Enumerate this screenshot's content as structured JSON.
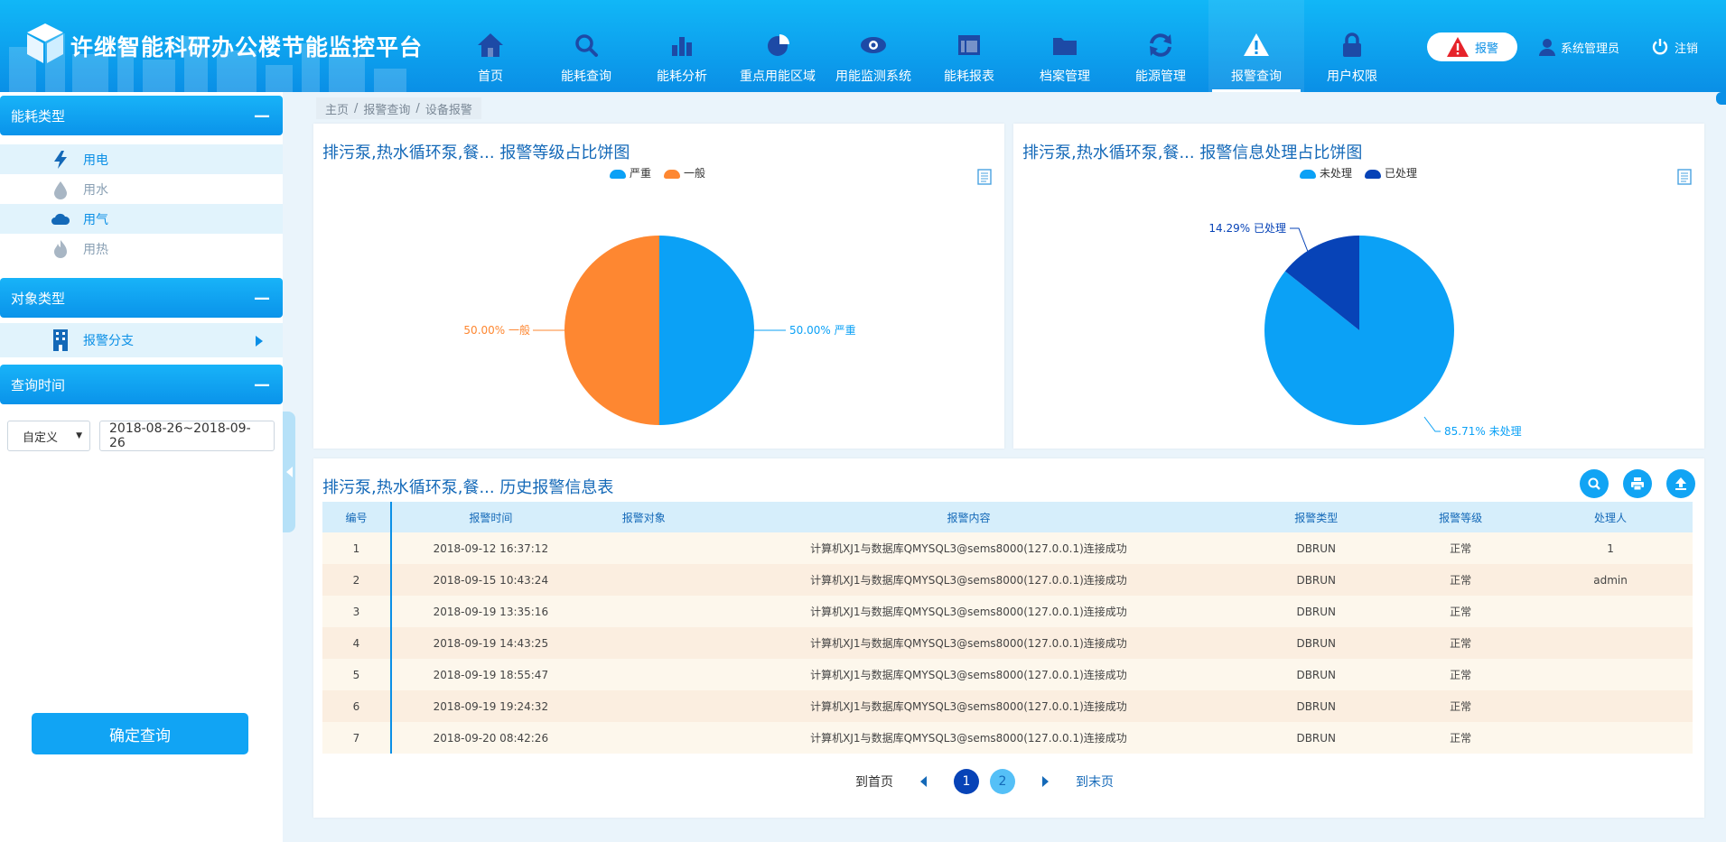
{
  "app": {
    "title": "许继智能科研办公楼节能监控平台"
  },
  "nav": [
    {
      "label": "首页",
      "icon": "home-icon"
    },
    {
      "label": "能耗查询",
      "icon": "search-icon"
    },
    {
      "label": "能耗分析",
      "icon": "bar-chart-icon"
    },
    {
      "label": "重点用能区域",
      "icon": "pie-icon"
    },
    {
      "label": "用能监测系统",
      "icon": "eye-icon"
    },
    {
      "label": "能耗报表",
      "icon": "report-icon"
    },
    {
      "label": "档案管理",
      "icon": "folder-icon"
    },
    {
      "label": "能源管理",
      "icon": "refresh-icon"
    },
    {
      "label": "报警查询",
      "icon": "warning-icon",
      "active": true
    },
    {
      "label": "用户权限",
      "icon": "lock-icon"
    }
  ],
  "header": {
    "alarm_label": "报警",
    "user_name": "系统管理员",
    "logout_label": "注销"
  },
  "sidebar": {
    "energy_panel_title": "能耗类型",
    "energy_items": [
      {
        "label": "用电",
        "icon": "lightning-icon",
        "selected": true
      },
      {
        "label": "用水",
        "icon": "water-drop-icon"
      },
      {
        "label": "用气",
        "icon": "cloud-icon",
        "selected": true
      },
      {
        "label": "用热",
        "icon": "flame-icon"
      }
    ],
    "object_panel_title": "对象类型",
    "object_item": "报警分支",
    "time_panel_title": "查询时间",
    "time_mode": "自定义",
    "date_range": "2018-08-26~2018-09-26",
    "confirm_label": "确定查询"
  },
  "breadcrumb": [
    "主页",
    "报警查询",
    "设备报警"
  ],
  "level_card": {
    "title": "排污泵,热水循环泵,餐...   报警等级占比饼图",
    "legend": [
      "严重",
      "一般"
    ],
    "labels": [
      "50.00%  严重",
      "50.00%  一般"
    ]
  },
  "process_card": {
    "title": "排污泵,热水循环泵,餐...   报警信息处理占比饼图",
    "legend": [
      "未处理",
      "已处理"
    ],
    "labels": [
      "85.71%  未处理",
      "14.29%  已处理"
    ]
  },
  "chart_data": [
    {
      "type": "pie",
      "title": "报警等级占比饼图",
      "categories": [
        "严重",
        "一般"
      ],
      "values": [
        50.0,
        50.0
      ],
      "colors": [
        "#0ba1f6",
        "#fe8731"
      ],
      "legend": "top-center"
    },
    {
      "type": "pie",
      "title": "报警信息处理占比饼图",
      "categories": [
        "未处理",
        "已处理"
      ],
      "values": [
        85.71,
        14.29
      ],
      "colors": [
        "#0ba1f6",
        "#0743b7"
      ],
      "legend": "top-center"
    }
  ],
  "history": {
    "title": "排污泵,热水循环泵,餐...   历史报警信息表",
    "columns": [
      "编号",
      "报警时间",
      "报警对象",
      "报警内容",
      "报警类型",
      "报警等级",
      "处理人"
    ],
    "rows": [
      [
        "1",
        "2018-09-12 16:37:12",
        "",
        "计算机XJ1与数据库QMYSQL3@sems8000(127.0.0.1)连接成功",
        "DBRUN",
        "正常",
        "1"
      ],
      [
        "2",
        "2018-09-15 10:43:24",
        "",
        "计算机XJ1与数据库QMYSQL3@sems8000(127.0.0.1)连接成功",
        "DBRUN",
        "正常",
        "admin"
      ],
      [
        "3",
        "2018-09-19 13:35:16",
        "",
        "计算机XJ1与数据库QMYSQL3@sems8000(127.0.0.1)连接成功",
        "DBRUN",
        "正常",
        ""
      ],
      [
        "4",
        "2018-09-19 14:43:25",
        "",
        "计算机XJ1与数据库QMYSQL3@sems8000(127.0.0.1)连接成功",
        "DBRUN",
        "正常",
        ""
      ],
      [
        "5",
        "2018-09-19 18:55:47",
        "",
        "计算机XJ1与数据库QMYSQL3@sems8000(127.0.0.1)连接成功",
        "DBRUN",
        "正常",
        ""
      ],
      [
        "6",
        "2018-09-19 19:24:32",
        "",
        "计算机XJ1与数据库QMYSQL3@sems8000(127.0.0.1)连接成功",
        "DBRUN",
        "正常",
        ""
      ],
      [
        "7",
        "2018-09-20 08:42:26",
        "",
        "计算机XJ1与数据库QMYSQL3@sems8000(127.0.0.1)连接成功",
        "DBRUN",
        "正常",
        ""
      ]
    ]
  },
  "pager": {
    "first_label": "到首页",
    "pages": [
      "1",
      "2"
    ],
    "current": "1",
    "last_label": "到末页"
  }
}
